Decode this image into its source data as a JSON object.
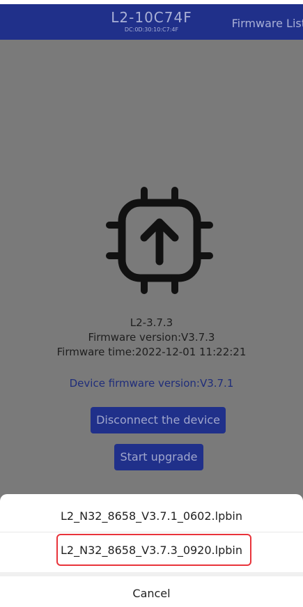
{
  "header": {
    "title": "L2-10C74F",
    "subtitle": "DC:0D:30:10:C7:4F",
    "firmware_list": "Firmware List"
  },
  "device": {
    "name": "L2-3.7.3",
    "firmware_version": "Firmware version:V3.7.3",
    "firmware_time": "Firmware time:2022-12-01 11:22:21",
    "device_firmware_version": "Device firmware version:V3.7.1"
  },
  "buttons": {
    "disconnect": "Disconnect the device",
    "start_upgrade": "Start upgrade"
  },
  "sheet": {
    "options": [
      "L2_N32_8658_V3.7.1_0602.lpbin",
      "L2_N32_8658_V3.7.3_0920.lpbin"
    ],
    "cancel": "Cancel"
  },
  "icons": {
    "upload": "chip-upload-icon"
  },
  "colors": {
    "header": "#20308a",
    "highlight": "#e8333a"
  }
}
